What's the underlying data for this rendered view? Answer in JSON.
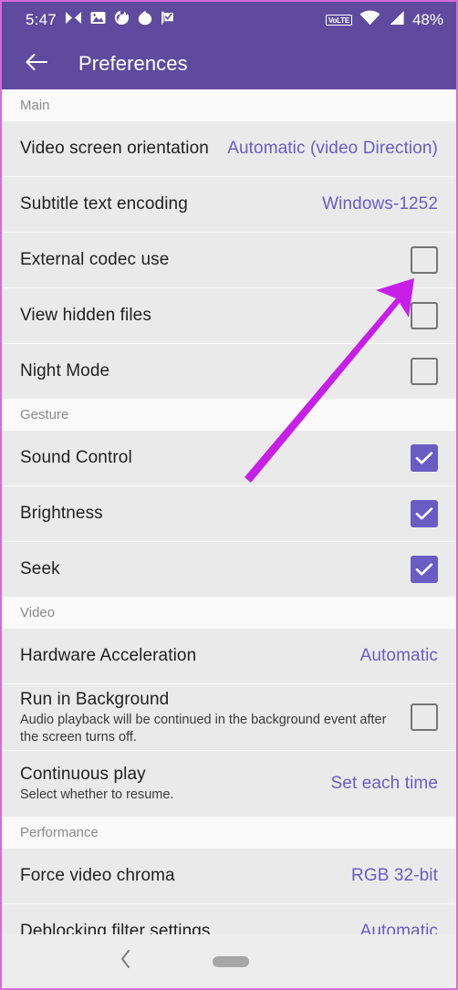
{
  "status_bar": {
    "time": "5:47",
    "battery": "48%",
    "network_badge": "VoLTE",
    "left_icons": [
      "messaging-icon",
      "photos-icon",
      "firefox-icon",
      "app-icon",
      "tasks-icon"
    ],
    "right_icons": [
      "volte-icon",
      "wifi-icon",
      "signal-icon"
    ]
  },
  "app_bar": {
    "title": "Preferences",
    "back_icon": "arrow-left-icon"
  },
  "sections": [
    {
      "header": "Main",
      "rows": [
        {
          "title": "Video screen orientation",
          "subtitle": "",
          "type": "value",
          "value": "Automatic (video Direction)"
        },
        {
          "title": "Subtitle text encoding",
          "subtitle": "",
          "type": "value",
          "value": "Windows-1252"
        },
        {
          "title": "External codec use",
          "subtitle": "",
          "type": "checkbox",
          "checked": false
        },
        {
          "title": "View hidden files",
          "subtitle": "",
          "type": "checkbox",
          "checked": false
        },
        {
          "title": "Night Mode",
          "subtitle": "",
          "type": "checkbox",
          "checked": false
        }
      ]
    },
    {
      "header": "Gesture",
      "rows": [
        {
          "title": "Sound Control",
          "subtitle": "",
          "type": "checkbox",
          "checked": true
        },
        {
          "title": "Brightness",
          "subtitle": "",
          "type": "checkbox",
          "checked": true
        },
        {
          "title": "Seek",
          "subtitle": "",
          "type": "checkbox",
          "checked": true
        }
      ]
    },
    {
      "header": "Video",
      "rows": [
        {
          "title": "Hardware Acceleration",
          "subtitle": "",
          "type": "value",
          "value": "Automatic"
        },
        {
          "title": "Run in Background",
          "subtitle": "Audio playback will be continued in the background event after the screen turns off.",
          "type": "checkbox",
          "checked": false
        },
        {
          "title": "Continuous play",
          "subtitle": "Select whether to resume.",
          "type": "value",
          "value": "Set each time"
        }
      ]
    },
    {
      "header": "Performance",
      "rows": [
        {
          "title": "Force video chroma",
          "subtitle": "",
          "type": "value",
          "value": "RGB 32-bit"
        },
        {
          "title": "Deblocking filter settings",
          "subtitle": "",
          "type": "value",
          "value": "Automatic"
        }
      ]
    }
  ],
  "nav_bar": {
    "back_icon": "chevron-left-icon",
    "home_icon": "home-pill-icon"
  },
  "annotation": {
    "type": "arrow",
    "color": "#C71FE8",
    "points_to": "external-codec-use-checkbox"
  },
  "colors": {
    "app_bar": "#5E4B9E",
    "accent": "#6B5CC4",
    "row_bg": "#EAEAEA",
    "section_bg": "#FAFAFA",
    "annotation": "#C71FE8"
  }
}
